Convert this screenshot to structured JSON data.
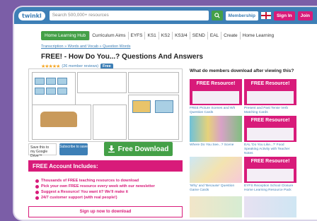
{
  "header": {
    "logo": "twinkl",
    "search_placeholder": "Search 500,000+ resources",
    "membership": "Membership",
    "sign_in": "Sign In",
    "join": "Join"
  },
  "subnav": [
    "Home Learning Hub",
    "Curriculum Aims",
    "EYFS",
    "KS1",
    "KS2",
    "KS3/4",
    "SEND",
    "EAL",
    "Create",
    "Home Learning"
  ],
  "breadcrumb": "Transcription » Words and Vocab » Question Words",
  "page": {
    "title": "FREE! - How Do You...? Questions And Answers",
    "reviews": "(26 member reviews)",
    "badge": "Free"
  },
  "actions": {
    "save": "Save this to my Google Drive™",
    "subscribe": "Subscribe to save",
    "download": "Free Download"
  },
  "account": {
    "heading": "FREE Account Includes:",
    "items": [
      "Thousands of FREE teaching resources to download",
      "Pick your own FREE resource every week with our newsletter",
      "Suggest a Resource! You want it? We'll make it",
      "24/7 customer support (with real people!)"
    ],
    "signup": "Sign up now to download"
  },
  "related": {
    "heading": "What do members download after viewing this?",
    "cards": [
      {
        "banner": "FREE Resource!",
        "caption": "FREE Picture Scenes and Wh Question Cards"
      },
      {
        "banner": "FREE Resource!",
        "caption": "Present and Past Tense Verb Matching Cards"
      },
      {
        "banner": "",
        "caption": "Where Do You See...? Scene"
      },
      {
        "banner": "FREE Resource!",
        "caption": "EAL 'Do You Like...?' Food Speaking Activity with Teacher Notes"
      },
      {
        "banner": "",
        "caption": "'Why' and 'Because' Question Game Cards"
      },
      {
        "banner": "FREE Resource!",
        "caption": "EYFS Reception School Closure Home Learning Resource Pack"
      }
    ]
  },
  "colors": {
    "brand_blue": "#3d7fb6",
    "accent_green": "#44a047",
    "accent_pink": "#d81b7a",
    "background_purple": "#7b5ea7"
  }
}
